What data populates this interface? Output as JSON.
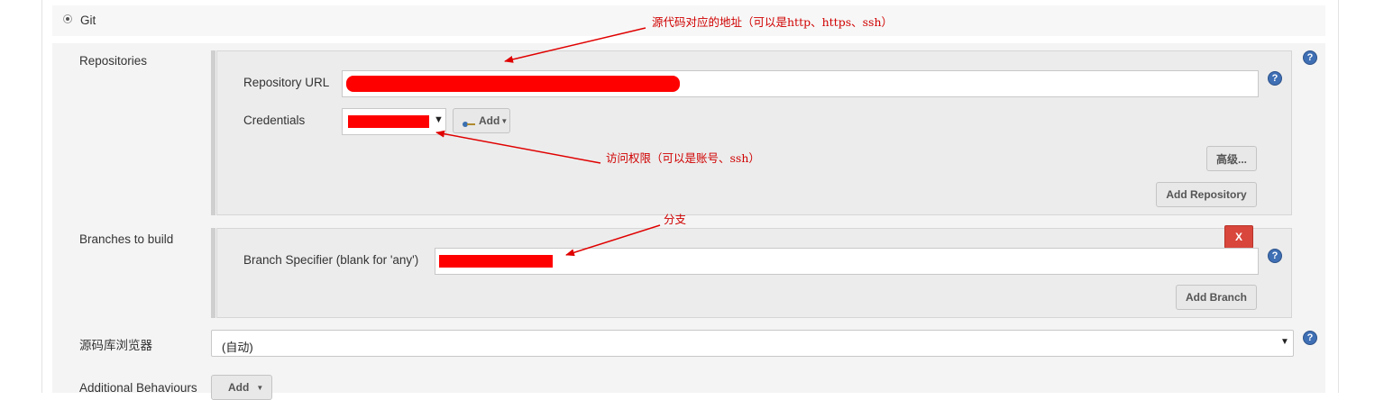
{
  "scm": {
    "git_label": "Git"
  },
  "repositories": {
    "label": "Repositories",
    "url_label": "Repository URL",
    "credentials_label": "Credentials",
    "credentials_add_label": "Add",
    "advanced_label": "高级...",
    "add_repository_label": "Add Repository"
  },
  "branches": {
    "label": "Branches to build",
    "specifier_label": "Branch Specifier (blank for 'any')",
    "delete_label": "X",
    "add_branch_label": "Add Branch"
  },
  "browser": {
    "label": "源码库浏览器",
    "selected": "(自动)"
  },
  "behaviours": {
    "label": "Additional Behaviours",
    "add_label": "Add"
  },
  "annotations": {
    "url_note": "源代码对应的地址（可以是http、https、ssh）",
    "credentials_note": "访问权限（可以是账号、ssh）",
    "branch_note": "分支"
  },
  "icons": {
    "help": "help-icon",
    "key": "key-icon",
    "dropdown": "caret-down-icon"
  },
  "colors": {
    "annotation": "#d00000",
    "redaction": "#ff0000",
    "help": "#3f6fb4",
    "delete": "#d9463c"
  }
}
